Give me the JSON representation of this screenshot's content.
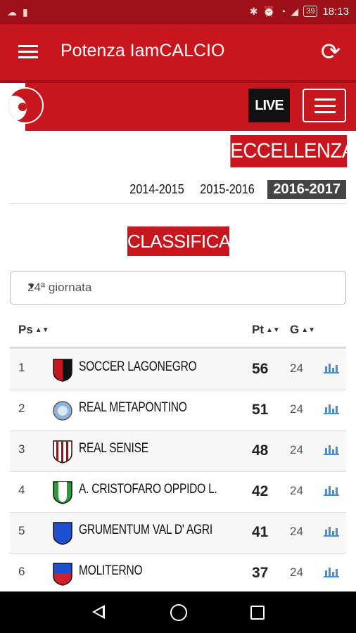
{
  "status_bar": {
    "time": "18:13",
    "battery": "39",
    "icons": [
      "cloud-icon",
      "battery-saver-icon",
      "bluetooth-icon",
      "alarm-icon",
      "wifi-icon",
      "signal-icon",
      "battery-icon"
    ]
  },
  "app_bar": {
    "title": "Potenza IamCALCIO",
    "menu_icon": "hamburger-icon",
    "refresh_icon": "refresh-icon"
  },
  "site_header": {
    "live_label": "LIVE",
    "logo_icon": "soccer-ball-logo"
  },
  "league": {
    "name": "ECCELLENZA",
    "seasons": [
      "2014-2015",
      "2015-2016",
      "2016-2017"
    ],
    "active_season": "2016-2017"
  },
  "standings": {
    "heading": "CLASSIFICA",
    "round_select": "24ª giornata",
    "columns": {
      "position": "Ps",
      "points": "Pt",
      "games": "G"
    },
    "rows": [
      {
        "pos": "1",
        "team": "SOCCER LAGONEGRO",
        "pts": "56",
        "g": "24",
        "crest": "red-black"
      },
      {
        "pos": "2",
        "team": "REAL METAPONTINO",
        "pts": "51",
        "g": "24",
        "crest": "round-blue"
      },
      {
        "pos": "3",
        "team": "REAL SENISE",
        "pts": "48",
        "g": "24",
        "crest": "red-white-stripes"
      },
      {
        "pos": "4",
        "team": "A. CRISTOFARO OPPIDO L.",
        "pts": "42",
        "g": "24",
        "crest": "green-white"
      },
      {
        "pos": "5",
        "team": "GRUMENTUM VAL D' AGRI",
        "pts": "41",
        "g": "24",
        "crest": "blue"
      },
      {
        "pos": "6",
        "team": "MOLITERNO",
        "pts": "37",
        "g": "24",
        "crest": "blue-red"
      }
    ]
  },
  "colors": {
    "primary": "#c8161e",
    "status_bar": "#9e1018",
    "chart_icon": "#4a8fd1"
  }
}
